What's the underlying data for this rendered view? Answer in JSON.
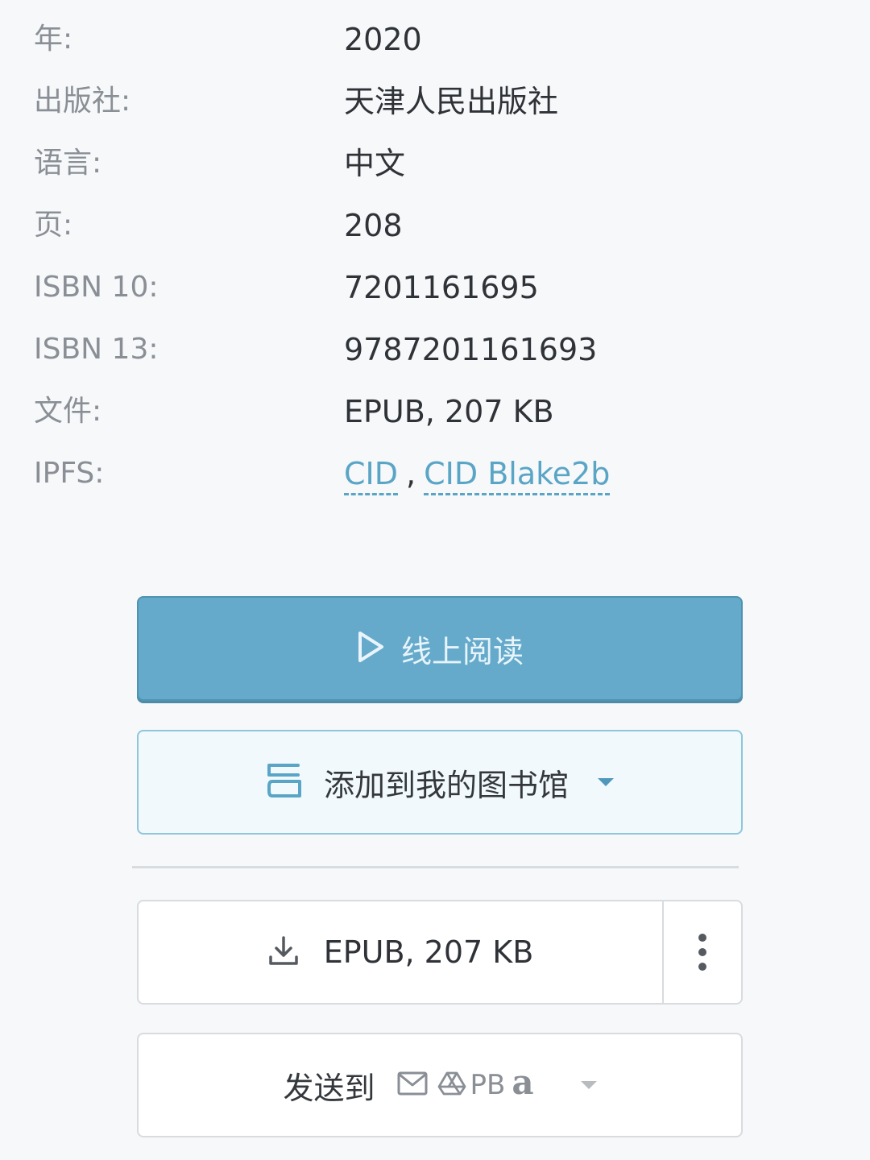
{
  "details": [
    {
      "label": "年:",
      "value": "2020"
    },
    {
      "label": "出版社:",
      "value": "天津人民出版社"
    },
    {
      "label": "语言:",
      "value": "中文"
    },
    {
      "label": "页:",
      "value": "208"
    },
    {
      "label": "ISBN 10:",
      "value": "7201161695"
    },
    {
      "label": "ISBN 13:",
      "value": "9787201161693"
    },
    {
      "label": "文件:",
      "value": "EPUB, 207 KB"
    },
    {
      "label": "IPFS:",
      "links": [
        "CID",
        "CID Blake2b"
      ],
      "separator": ","
    }
  ],
  "actions": {
    "read_online": {
      "label": "线上阅读",
      "icon": "play-icon"
    },
    "add_to_library": {
      "label": "添加到我的图书馆",
      "icon": "bookshelf-icon"
    },
    "download": {
      "label": "EPUB, 207 KB",
      "icon": "download-icon",
      "more_icon": "more-vertical-icon"
    },
    "send_to": {
      "label": "发送到",
      "targets": [
        "email-icon",
        "google-drive-icon",
        "PB",
        "a"
      ]
    }
  },
  "colors": {
    "accent": "#65aacb",
    "link": "#5aa5c6",
    "label_gray": "#8a8f96",
    "text": "#2f3236"
  }
}
